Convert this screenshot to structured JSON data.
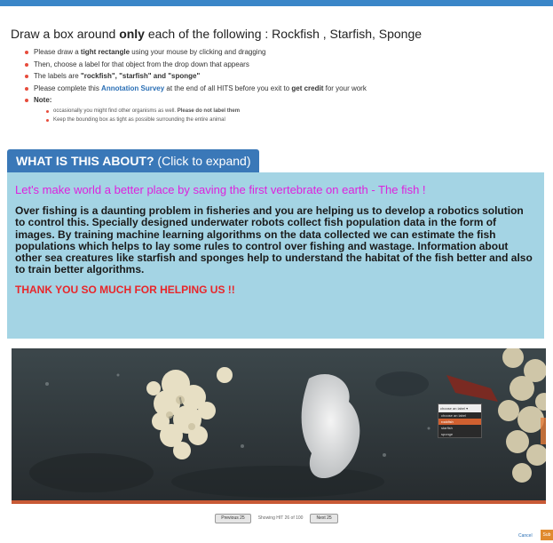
{
  "instructions": {
    "title_pre": "Draw a box around ",
    "title_bold": "only",
    "title_post": " each of the following : Rockfish , Starfish, Sponge",
    "item1_pre": "Please draw a ",
    "item1_bold": "tight rectangle",
    "item1_post": " using your mouse by clicking and dragging",
    "item2": "Then, choose a label for that object from the drop down that appears",
    "item3_pre": "The labels are ",
    "item3_bold": "\"rockfish\", \"starfish\" and \"sponge\"",
    "item4_pre": "Please complete this ",
    "item4_link": "Annotation Survey",
    "item4_mid": " at the end of all HITS before you exit to ",
    "item4_bold": "get credit",
    "item4_post": " for your work",
    "note_label": "Note:",
    "note1_pre": "occasionally you might find other organisms as well. ",
    "note1_bold": "Please do not label them",
    "note2": "Keep the bounding box as tight as possible surrounding the entire animal"
  },
  "about": {
    "tab_bold": "WHAT IS THIS ABOUT?",
    "tab_rest": " (Click to expand)",
    "heading": "Let's make world a better place by saving the first vertebrate on earth - The fish !",
    "body": "Over fishing is a daunting problem in fisheries and you are helping us to develop a robotics solution to control this. Specially designed underwater robots collect fish population data in the form of images. By training machine learning algorithms on the data collected we can estimate the fish populations which helps to lay some rules to control over fishing and wastage. Information about other sea creatures like starfish and sponges help to understand the habitat of the fish better and also to train better algorithms.",
    "thanks": "THANK YOU SO MUCH FOR HELPING US !!"
  },
  "dropdown": {
    "header": "choose an label ▾",
    "options": [
      "choose an label",
      "rockfish",
      "starfish",
      "sponge"
    ],
    "selected_index": 1
  },
  "footer": {
    "prev_label": "Previous 25",
    "counter": "Showing HIT 26 of 100",
    "next_label": "Next 25",
    "cancel_label": "Cancel",
    "submit_label": "Sub"
  },
  "colors": {
    "accent": "#3a78b8",
    "panel_bg": "#a4d4e4",
    "heading_magenta": "#dd22dd",
    "thanks_red": "#e8262a",
    "submit_orange": "#e08a2e"
  }
}
